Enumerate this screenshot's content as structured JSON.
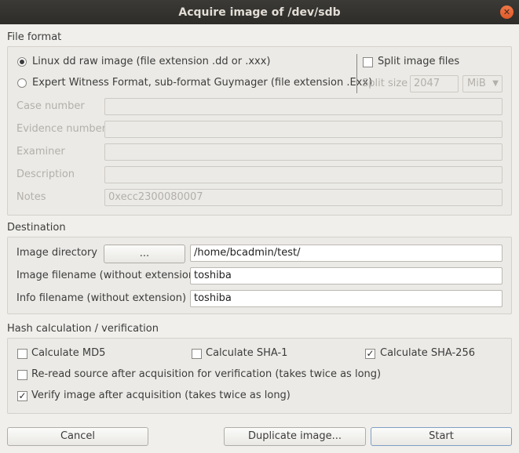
{
  "window": {
    "title": "Acquire image of /dev/sdb"
  },
  "file_format": {
    "title": "File format",
    "options": [
      {
        "label": "Linux dd raw image (file extension .dd or .xxx)",
        "selected": true
      },
      {
        "label": "Expert Witness Format, sub-format Guymager (file extension .Exx)",
        "selected": false
      }
    ],
    "split": {
      "label": "Split image files",
      "checked": false,
      "size_label": "Split size",
      "size_value": "2047",
      "unit": "MiB"
    },
    "fields": [
      {
        "label": "Case number",
        "value": ""
      },
      {
        "label": "Evidence number",
        "value": ""
      },
      {
        "label": "Examiner",
        "value": ""
      },
      {
        "label": "Description",
        "value": ""
      },
      {
        "label": "Notes",
        "value": "0xecc2300080007"
      }
    ]
  },
  "destination": {
    "title": "Destination",
    "image_directory_label": "Image directory",
    "browse_label": "...",
    "image_directory": "/home/bcadmin/test/",
    "image_filename_label": "Image filename (without extension)",
    "image_filename": "toshiba",
    "info_filename_label": "Info filename (without extension)",
    "info_filename": "toshiba"
  },
  "hash": {
    "title": "Hash calculation / verification",
    "md5": {
      "label": "Calculate MD5",
      "checked": false
    },
    "sha1": {
      "label": "Calculate SHA-1",
      "checked": false
    },
    "sha256": {
      "label": "Calculate SHA-256",
      "checked": true
    },
    "reread": {
      "label": "Re-read source after acquisition for verification (takes twice as long)",
      "checked": false
    },
    "verify": {
      "label": "Verify image after acquisition (takes twice as long)",
      "checked": true
    }
  },
  "buttons": {
    "cancel": "Cancel",
    "duplicate": "Duplicate image...",
    "start": "Start"
  },
  "colors": {
    "titlebar": "#2d2c29",
    "close": "#e05a2a",
    "background": "#f0efeb",
    "default_button_border": "#7d9ec5"
  }
}
